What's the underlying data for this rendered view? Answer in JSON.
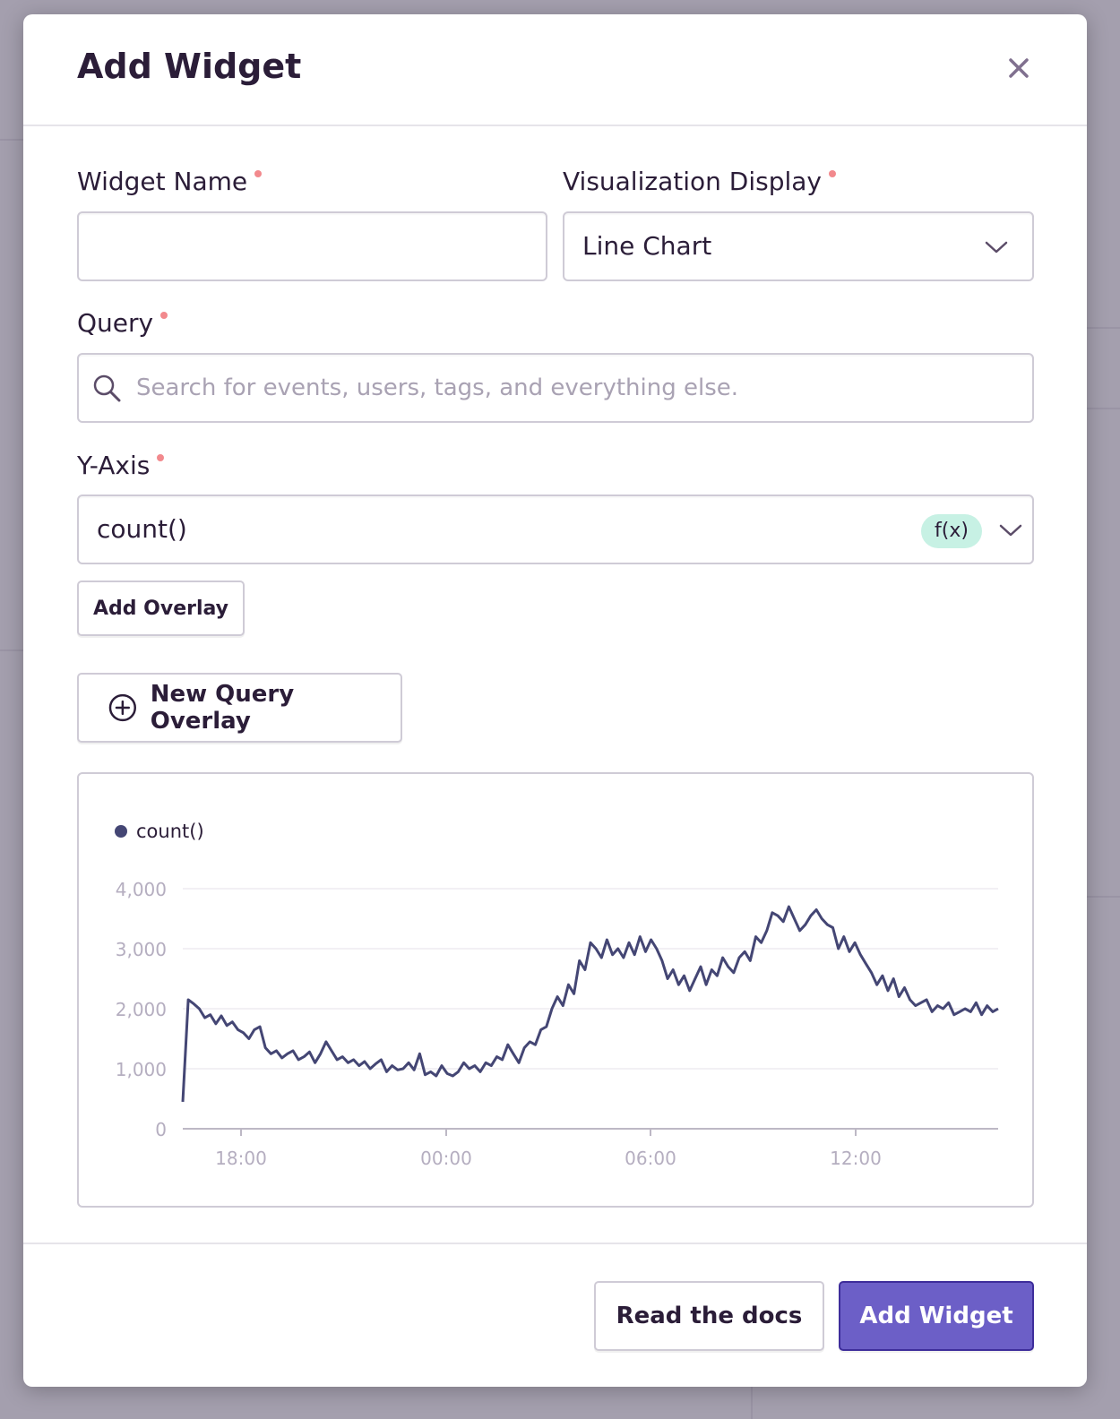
{
  "modal": {
    "title": "Add Widget"
  },
  "form": {
    "widget_name": {
      "label": "Widget Name",
      "value": "",
      "placeholder": ""
    },
    "visualization": {
      "label": "Visualization Display",
      "selected": "Line Chart"
    },
    "query": {
      "label": "Query",
      "placeholder": "Search for events, users, tags, and everything else."
    },
    "y_axis": {
      "label": "Y-Axis",
      "value": "count()",
      "function_badge": "f(x)"
    },
    "add_overlay_label": "Add Overlay",
    "new_query_overlay_label": "New Query Overlay"
  },
  "footer": {
    "docs_label": "Read the docs",
    "submit_label": "Add Widget"
  },
  "colors": {
    "accent": "#6c5fc7",
    "required_dot": "#f2898d",
    "series": "#444674",
    "badge_bg": "#c7f1e4"
  },
  "chart_data": {
    "type": "line",
    "series": [
      {
        "name": "count()",
        "values": [
          450,
          2150,
          2080,
          2000,
          1850,
          1900,
          1750,
          1880,
          1720,
          1780,
          1650,
          1600,
          1500,
          1650,
          1700,
          1350,
          1250,
          1300,
          1180,
          1250,
          1300,
          1150,
          1200,
          1280,
          1100,
          1250,
          1450,
          1300,
          1150,
          1200,
          1100,
          1150,
          1050,
          1120,
          1000,
          1080,
          1150,
          950,
          1050,
          980,
          1000,
          1100,
          980,
          1250,
          900,
          950,
          880,
          1050,
          920,
          880,
          950,
          1100,
          1000,
          1050,
          950,
          1100,
          1050,
          1200,
          1150,
          1400,
          1250,
          1100,
          1350,
          1450,
          1400,
          1650,
          1700,
          2000,
          2200,
          2050,
          2400,
          2250,
          2800,
          2650,
          3100,
          3000,
          2850,
          3150,
          2900,
          3000,
          2850,
          3100,
          2900,
          3200,
          2950,
          3150,
          3000,
          2800,
          2500,
          2650,
          2400,
          2550,
          2300,
          2500,
          2700,
          2400,
          2650,
          2550,
          2850,
          2700,
          2600,
          2850,
          2950,
          2800,
          3200,
          3100,
          3300,
          3600,
          3550,
          3450,
          3700,
          3500,
          3300,
          3400,
          3550,
          3650,
          3500,
          3400,
          3350,
          3000,
          3200,
          2950,
          3100,
          2900,
          2750,
          2600,
          2400,
          2550,
          2300,
          2500,
          2200,
          2350,
          2150,
          2050,
          2100,
          2150,
          1950,
          2050,
          2000,
          2100,
          1900,
          1950,
          2000,
          1950,
          2100,
          1900,
          2050,
          1950,
          2000
        ],
        "x_start": "16:00",
        "x_end": "15:45"
      }
    ],
    "xticks": [
      "18:00",
      "00:00",
      "06:00",
      "12:00"
    ],
    "yticks": [
      "0",
      "1,000",
      "2,000",
      "3,000",
      "4,000"
    ],
    "ylim": [
      0,
      4000
    ],
    "legend": "top-left",
    "grid": true
  }
}
